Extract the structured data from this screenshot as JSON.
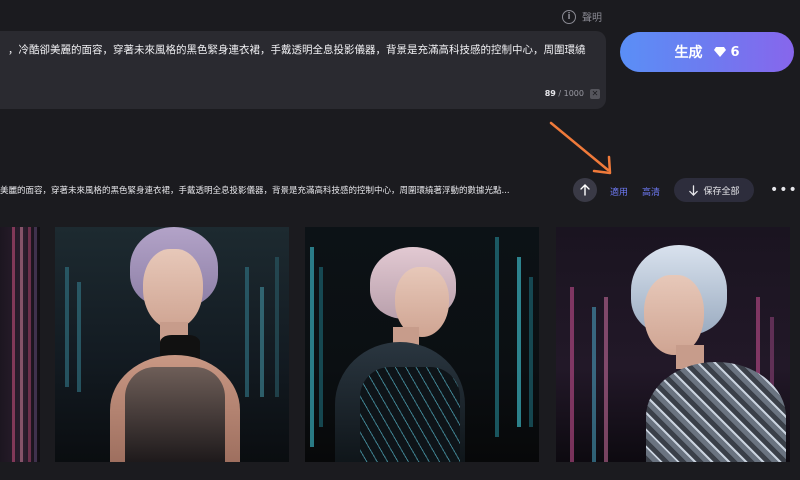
{
  "header": {
    "disclaimer_label": "聲明"
  },
  "prompt": {
    "text": "，冷酷卻美麗的面容，穿著未來風格的黑色緊身連衣裙，手戴透明全息投影儀器，背景是充滿高科技感的控制中心，周圍環繞",
    "count": "89",
    "max": "/ 1000"
  },
  "generate": {
    "label": "生成",
    "cost": "6"
  },
  "result_bar": {
    "prompt_text": "美麗的面容，穿著未來風格的黑色緊身連衣裙，手戴透明全息投影儀器，背景是充滿高科技感的控制中心，周圍環繞著浮動的數據光點...",
    "apply_label": "適用",
    "hd_label": "高清",
    "save_all_label": "保存全部",
    "more_label": "•••"
  },
  "gallery": {
    "images": [
      {
        "name": "partial-result-image"
      },
      {
        "name": "result-image-1"
      },
      {
        "name": "result-image-2"
      },
      {
        "name": "result-image-3"
      }
    ]
  },
  "colors": {
    "background": "#1b1b1f",
    "accent_gradient_start": "#5a8ff6",
    "accent_gradient_end": "#8766ec",
    "link": "#6d78f2",
    "annotation_arrow": "#f07a3a"
  },
  "icons": [
    "info-icon",
    "diamond-icon",
    "arrow-up-icon",
    "arrow-down-icon",
    "more-icon",
    "clear-icon"
  ]
}
